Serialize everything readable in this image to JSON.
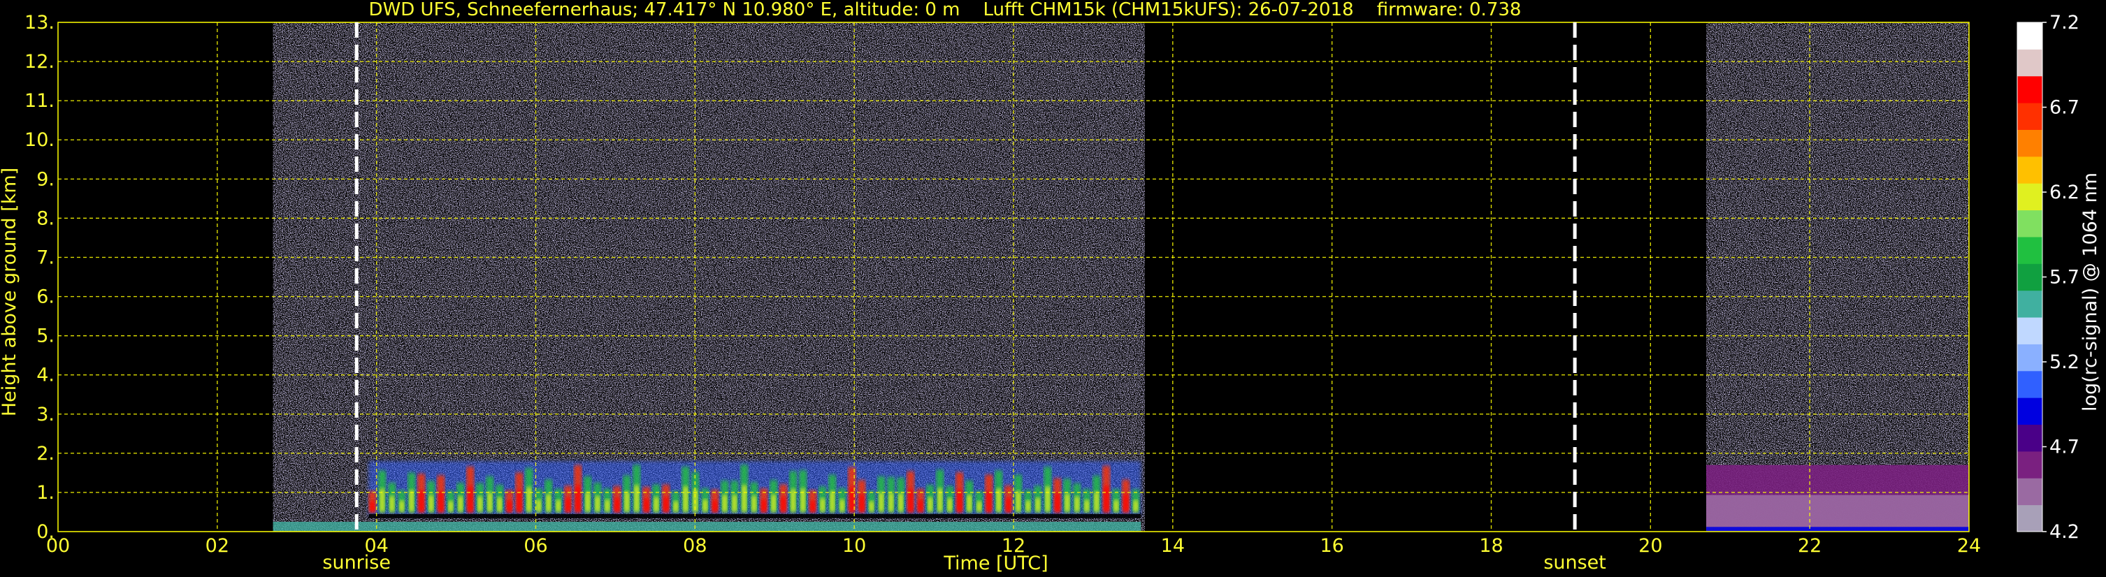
{
  "chart_data": {
    "type": "heatmap",
    "title": "DWD UFS, Schneefernerhaus; 47.417° N 10.980° E, altitude: 0 m    Lufft CHM15k (CHM15kUFS): 26-07-2018    firmware: 0.738",
    "xlabel": "Time [UTC]",
    "ylabel": "Height above ground [km]",
    "xlim": [
      0,
      24
    ],
    "ylim": [
      0,
      13
    ],
    "xtick_labels": [
      "00",
      "02",
      "04",
      "06",
      "08",
      "10",
      "12",
      "14",
      "16",
      "18",
      "20",
      "22",
      "24"
    ],
    "ytick_labels": [
      "0.",
      "1.",
      "2.",
      "3.",
      "4.",
      "5.",
      "6.",
      "7.",
      "8.",
      "9.",
      "10.",
      "11.",
      "12.",
      "13."
    ],
    "grid": true,
    "data_segments_hours": [
      [
        2.7,
        13.65
      ],
      [
        20.7,
        24.0
      ]
    ],
    "markers": [
      {
        "label": "sunrise",
        "time": 3.75
      },
      {
        "label": "sunset",
        "time": 19.05
      }
    ],
    "colorbar": {
      "label": "log(rc-signal) @ 1064 nm",
      "range": [
        4.2,
        7.2
      ],
      "tick_labels": [
        "4.2",
        "4.7",
        "5.2",
        "5.7",
        "6.2",
        "6.7",
        "7.2"
      ]
    },
    "cloud_layers_km": [
      {
        "start": 3.9,
        "end": 13.6,
        "bottom": 0.4,
        "top": 1.8
      },
      {
        "start": 20.7,
        "end": 24.0,
        "bottom": 0.0,
        "top": 1.7
      }
    ]
  },
  "colors": {
    "text": "#ffff33",
    "grid": "#ffff00",
    "background": "#000000",
    "marker": "#ffffff",
    "colormap": [
      "#a8a0b8",
      "#9a6aa2",
      "#7a2080",
      "#4a0088",
      "#0000e0",
      "#3060ff",
      "#8ab0ff",
      "#c0d8ff",
      "#40b0a0",
      "#10a040",
      "#20c040",
      "#80e060",
      "#e0f020",
      "#ffc000",
      "#ff8000",
      "#ff3000",
      "#ff0000",
      "#e0c8c8",
      "#ffffff"
    ]
  }
}
